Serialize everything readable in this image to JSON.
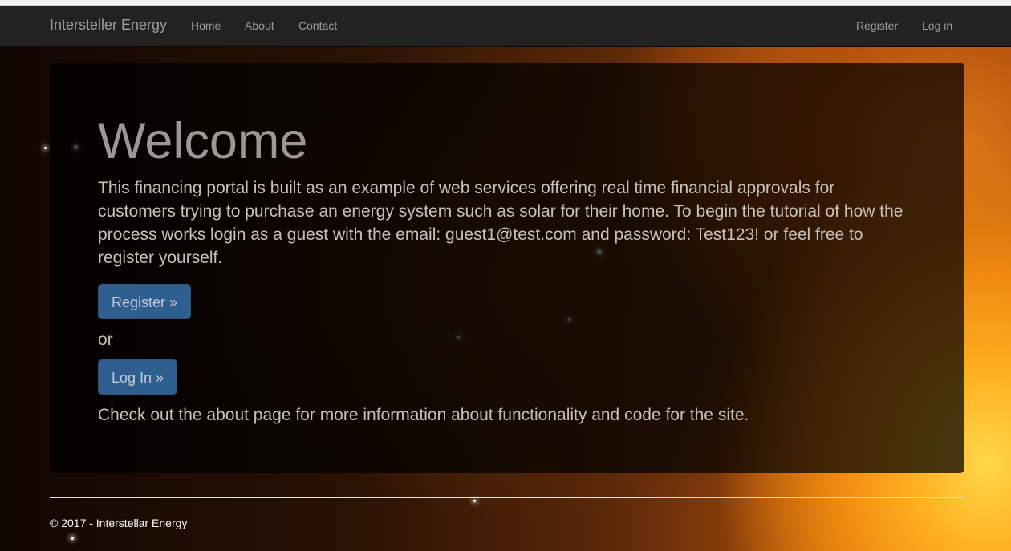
{
  "navbar": {
    "brand": "Intersteller Energy",
    "links": [
      "Home",
      "About",
      "Contact"
    ],
    "right_links": [
      "Register",
      "Log in"
    ]
  },
  "hero": {
    "title": "Welcome",
    "intro": "This financing portal is built as an example of web services offering real time financial approvals for customers trying to purchase an energy system such as solar for their home. To begin the tutorial of how the process works login as a guest with the email: guest1@test.com and password: Test123! or feel free to register yourself.",
    "register_button": "Register »",
    "or_text": "or",
    "login_button": "Log In »",
    "about_text": "Check out the about page for more information about functionality and code for the site."
  },
  "footer": {
    "copyright": "© 2017 - Interstellar Energy"
  }
}
